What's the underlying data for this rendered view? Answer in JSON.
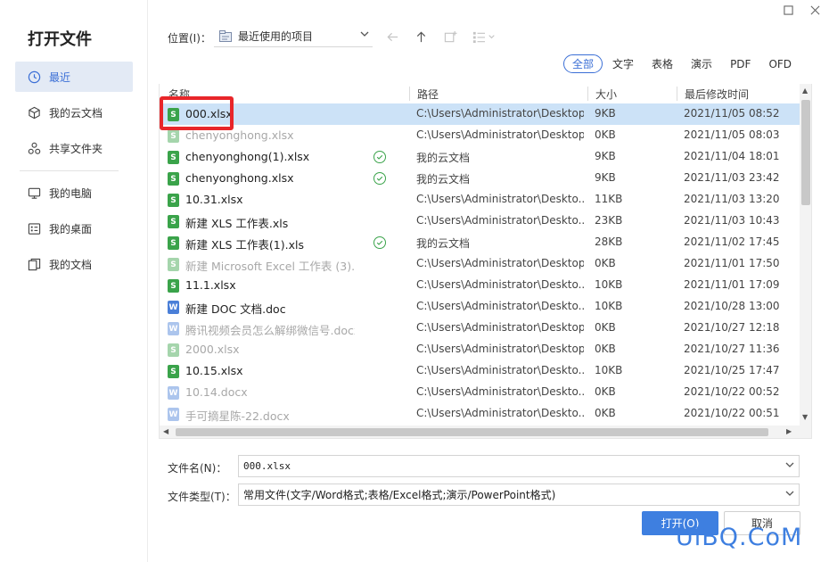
{
  "dialog": {
    "title": "打开文件"
  },
  "sidebar": {
    "items": [
      {
        "label": "最近",
        "icon": "clock-icon"
      },
      {
        "label": "我的云文档",
        "icon": "cloud-box-icon"
      },
      {
        "label": "共享文件夹",
        "icon": "share-nodes-icon"
      },
      {
        "label": "我的电脑",
        "icon": "monitor-icon"
      },
      {
        "label": "我的桌面",
        "icon": "desktop-grid-icon"
      },
      {
        "label": "我的文档",
        "icon": "documents-icon"
      }
    ]
  },
  "location": {
    "label": "位置(I)：",
    "value": "最近使用的项目"
  },
  "filters": [
    "全部",
    "文字",
    "表格",
    "演示",
    "PDF",
    "OFD"
  ],
  "columns": {
    "name": "名称",
    "path": "路径",
    "size": "大小",
    "modified": "最后修改时间"
  },
  "files": [
    {
      "name": "000.xlsx",
      "path": "C:\\Users\\Administrator\\Desktop",
      "size": "9KB",
      "modified": "2021/11/05 08:52",
      "type": "xls",
      "cloud": false,
      "faded": false,
      "selected": true
    },
    {
      "name": "chenyonghong.xlsx",
      "path": "C:\\Users\\Administrator\\Desktop",
      "size": "0KB",
      "modified": "2021/11/05 08:03",
      "type": "xls",
      "cloud": false,
      "faded": true,
      "selected": false
    },
    {
      "name": "chenyonghong(1).xlsx",
      "path": "我的云文档",
      "size": "9KB",
      "modified": "2021/11/04 18:01",
      "type": "xls",
      "cloud": true,
      "faded": false,
      "selected": false
    },
    {
      "name": "chenyonghong.xlsx",
      "path": "我的云文档",
      "size": "9KB",
      "modified": "2021/11/03 23:42",
      "type": "xls",
      "cloud": true,
      "faded": false,
      "selected": false
    },
    {
      "name": "10.31.xlsx",
      "path": "C:\\Users\\Administrator\\Deskto...",
      "size": "11KB",
      "modified": "2021/11/03 13:20",
      "type": "xls",
      "cloud": false,
      "faded": false,
      "selected": false
    },
    {
      "name": "新建 XLS 工作表.xls",
      "path": "C:\\Users\\Administrator\\Deskto...",
      "size": "23KB",
      "modified": "2021/11/03 10:43",
      "type": "xls",
      "cloud": false,
      "faded": false,
      "selected": false
    },
    {
      "name": "新建 XLS 工作表(1).xls",
      "path": "我的云文档",
      "size": "28KB",
      "modified": "2021/11/02 17:45",
      "type": "xls",
      "cloud": true,
      "faded": false,
      "selected": false
    },
    {
      "name": "新建 Microsoft Excel 工作表 (3)....",
      "path": "C:\\Users\\Administrator\\Desktop",
      "size": "0KB",
      "modified": "2021/11/01 17:50",
      "type": "xls",
      "cloud": false,
      "faded": true,
      "selected": false
    },
    {
      "name": "11.1.xlsx",
      "path": "C:\\Users\\Administrator\\Deskto...",
      "size": "10KB",
      "modified": "2021/11/01 17:09",
      "type": "xls",
      "cloud": false,
      "faded": false,
      "selected": false
    },
    {
      "name": "新建 DOC 文档.doc",
      "path": "C:\\Users\\Administrator\\Deskto...",
      "size": "10KB",
      "modified": "2021/10/28 13:00",
      "type": "doc",
      "cloud": false,
      "faded": false,
      "selected": false
    },
    {
      "name": "腾讯视频会员怎么解绑微信号.docx",
      "path": "C:\\Users\\Administrator\\Desktop",
      "size": "0KB",
      "modified": "2021/10/27 12:18",
      "type": "doc",
      "cloud": false,
      "faded": true,
      "selected": false
    },
    {
      "name": "2000.xlsx",
      "path": "C:\\Users\\Administrator\\Desktop",
      "size": "0KB",
      "modified": "2021/10/27 11:36",
      "type": "xls",
      "cloud": false,
      "faded": true,
      "selected": false
    },
    {
      "name": "10.15.xlsx",
      "path": "C:\\Users\\Administrator\\Deskto...",
      "size": "10KB",
      "modified": "2021/10/25 17:47",
      "type": "xls",
      "cloud": false,
      "faded": false,
      "selected": false
    },
    {
      "name": "10.14.docx",
      "path": "C:\\Users\\Administrator\\Deskto...",
      "size": "0KB",
      "modified": "2021/10/22 00:52",
      "type": "doc",
      "cloud": false,
      "faded": true,
      "selected": false
    },
    {
      "name": "手可摘星陈-22.docx",
      "path": "C:\\Users\\Administrator\\Deskto...",
      "size": "0KB",
      "modified": "2021/10/22 00:51",
      "type": "doc",
      "cloud": false,
      "faded": true,
      "selected": false
    }
  ],
  "form": {
    "filename_label": "文件名(N)：",
    "filename_value": "000.xlsx",
    "filetype_label": "文件类型(T)：",
    "filetype_value": "常用文件(文字/Word格式;表格/Excel格式;演示/PowerPoint格式)"
  },
  "buttons": {
    "open": "打开(O)",
    "cancel": "取消"
  },
  "watermark": "UiBQ.CoM",
  "colors": {
    "accent": "#3e7fe0",
    "selected_row": "#cce2f7",
    "highlight": "#e8262a",
    "excel": "#3aa34a",
    "word": "#4a7fd8"
  }
}
